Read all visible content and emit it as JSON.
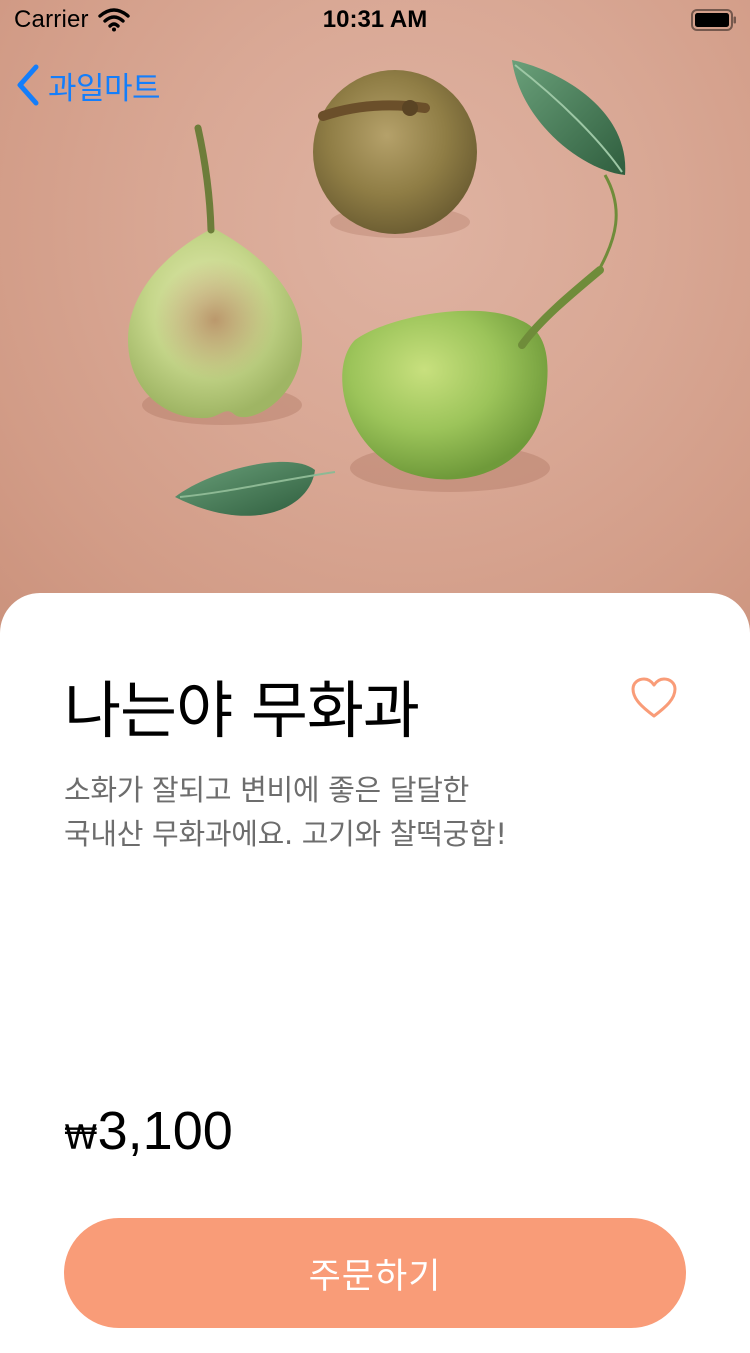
{
  "status_bar": {
    "carrier": "Carrier",
    "time": "10:31 AM",
    "wifi_icon": "wifi-icon",
    "battery_icon": "battery-icon"
  },
  "navigation": {
    "back_label": "과일마트",
    "back_icon": "chevron-left-icon"
  },
  "product": {
    "image_icon": "pears-photo",
    "title": "나는야 무화과",
    "description_lines": [
      "소화가 잘되고 변비에 좋은 달달한",
      "국내산 무화과에요. 고기와 찰떡궁합!"
    ],
    "price_currency": "₩",
    "price_amount": "3,100",
    "favorite_icon": "heart-outline-icon"
  },
  "actions": {
    "order_label": "주문하기"
  },
  "colors": {
    "accent": "#f99c78",
    "link": "#147efb",
    "photo_background": "#d9a895",
    "description_text": "#6d6d6d"
  }
}
